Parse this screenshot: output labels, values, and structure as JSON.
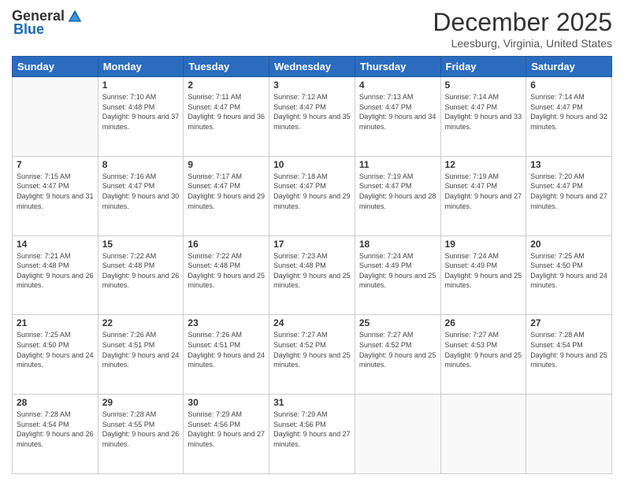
{
  "logo": {
    "general": "General",
    "blue": "Blue"
  },
  "header": {
    "month": "December 2025",
    "location": "Leesburg, Virginia, United States"
  },
  "days_of_week": [
    "Sunday",
    "Monday",
    "Tuesday",
    "Wednesday",
    "Thursday",
    "Friday",
    "Saturday"
  ],
  "weeks": [
    [
      {
        "day": "",
        "sunrise": "",
        "sunset": "",
        "daylight": ""
      },
      {
        "day": "1",
        "sunrise": "Sunrise: 7:10 AM",
        "sunset": "Sunset: 4:48 PM",
        "daylight": "Daylight: 9 hours and 37 minutes."
      },
      {
        "day": "2",
        "sunrise": "Sunrise: 7:11 AM",
        "sunset": "Sunset: 4:47 PM",
        "daylight": "Daylight: 9 hours and 36 minutes."
      },
      {
        "day": "3",
        "sunrise": "Sunrise: 7:12 AM",
        "sunset": "Sunset: 4:47 PM",
        "daylight": "Daylight: 9 hours and 35 minutes."
      },
      {
        "day": "4",
        "sunrise": "Sunrise: 7:13 AM",
        "sunset": "Sunset: 4:47 PM",
        "daylight": "Daylight: 9 hours and 34 minutes."
      },
      {
        "day": "5",
        "sunrise": "Sunrise: 7:14 AM",
        "sunset": "Sunset: 4:47 PM",
        "daylight": "Daylight: 9 hours and 33 minutes."
      },
      {
        "day": "6",
        "sunrise": "Sunrise: 7:14 AM",
        "sunset": "Sunset: 4:47 PM",
        "daylight": "Daylight: 9 hours and 32 minutes."
      }
    ],
    [
      {
        "day": "7",
        "sunrise": "Sunrise: 7:15 AM",
        "sunset": "Sunset: 4:47 PM",
        "daylight": "Daylight: 9 hours and 31 minutes."
      },
      {
        "day": "8",
        "sunrise": "Sunrise: 7:16 AM",
        "sunset": "Sunset: 4:47 PM",
        "daylight": "Daylight: 9 hours and 30 minutes."
      },
      {
        "day": "9",
        "sunrise": "Sunrise: 7:17 AM",
        "sunset": "Sunset: 4:47 PM",
        "daylight": "Daylight: 9 hours and 29 minutes."
      },
      {
        "day": "10",
        "sunrise": "Sunrise: 7:18 AM",
        "sunset": "Sunset: 4:47 PM",
        "daylight": "Daylight: 9 hours and 29 minutes."
      },
      {
        "day": "11",
        "sunrise": "Sunrise: 7:19 AM",
        "sunset": "Sunset: 4:47 PM",
        "daylight": "Daylight: 9 hours and 28 minutes."
      },
      {
        "day": "12",
        "sunrise": "Sunrise: 7:19 AM",
        "sunset": "Sunset: 4:47 PM",
        "daylight": "Daylight: 9 hours and 27 minutes."
      },
      {
        "day": "13",
        "sunrise": "Sunrise: 7:20 AM",
        "sunset": "Sunset: 4:47 PM",
        "daylight": "Daylight: 9 hours and 27 minutes."
      }
    ],
    [
      {
        "day": "14",
        "sunrise": "Sunrise: 7:21 AM",
        "sunset": "Sunset: 4:48 PM",
        "daylight": "Daylight: 9 hours and 26 minutes."
      },
      {
        "day": "15",
        "sunrise": "Sunrise: 7:22 AM",
        "sunset": "Sunset: 4:48 PM",
        "daylight": "Daylight: 9 hours and 26 minutes."
      },
      {
        "day": "16",
        "sunrise": "Sunrise: 7:22 AM",
        "sunset": "Sunset: 4:48 PM",
        "daylight": "Daylight: 9 hours and 25 minutes."
      },
      {
        "day": "17",
        "sunrise": "Sunrise: 7:23 AM",
        "sunset": "Sunset: 4:48 PM",
        "daylight": "Daylight: 9 hours and 25 minutes."
      },
      {
        "day": "18",
        "sunrise": "Sunrise: 7:24 AM",
        "sunset": "Sunset: 4:49 PM",
        "daylight": "Daylight: 9 hours and 25 minutes."
      },
      {
        "day": "19",
        "sunrise": "Sunrise: 7:24 AM",
        "sunset": "Sunset: 4:49 PM",
        "daylight": "Daylight: 9 hours and 25 minutes."
      },
      {
        "day": "20",
        "sunrise": "Sunrise: 7:25 AM",
        "sunset": "Sunset: 4:50 PM",
        "daylight": "Daylight: 9 hours and 24 minutes."
      }
    ],
    [
      {
        "day": "21",
        "sunrise": "Sunrise: 7:25 AM",
        "sunset": "Sunset: 4:50 PM",
        "daylight": "Daylight: 9 hours and 24 minutes."
      },
      {
        "day": "22",
        "sunrise": "Sunrise: 7:26 AM",
        "sunset": "Sunset: 4:51 PM",
        "daylight": "Daylight: 9 hours and 24 minutes."
      },
      {
        "day": "23",
        "sunrise": "Sunrise: 7:26 AM",
        "sunset": "Sunset: 4:51 PM",
        "daylight": "Daylight: 9 hours and 24 minutes."
      },
      {
        "day": "24",
        "sunrise": "Sunrise: 7:27 AM",
        "sunset": "Sunset: 4:52 PM",
        "daylight": "Daylight: 9 hours and 25 minutes."
      },
      {
        "day": "25",
        "sunrise": "Sunrise: 7:27 AM",
        "sunset": "Sunset: 4:52 PM",
        "daylight": "Daylight: 9 hours and 25 minutes."
      },
      {
        "day": "26",
        "sunrise": "Sunrise: 7:27 AM",
        "sunset": "Sunset: 4:53 PM",
        "daylight": "Daylight: 9 hours and 25 minutes."
      },
      {
        "day": "27",
        "sunrise": "Sunrise: 7:28 AM",
        "sunset": "Sunset: 4:54 PM",
        "daylight": "Daylight: 9 hours and 25 minutes."
      }
    ],
    [
      {
        "day": "28",
        "sunrise": "Sunrise: 7:28 AM",
        "sunset": "Sunset: 4:54 PM",
        "daylight": "Daylight: 9 hours and 26 minutes."
      },
      {
        "day": "29",
        "sunrise": "Sunrise: 7:28 AM",
        "sunset": "Sunset: 4:55 PM",
        "daylight": "Daylight: 9 hours and 26 minutes."
      },
      {
        "day": "30",
        "sunrise": "Sunrise: 7:29 AM",
        "sunset": "Sunset: 4:56 PM",
        "daylight": "Daylight: 9 hours and 27 minutes."
      },
      {
        "day": "31",
        "sunrise": "Sunrise: 7:29 AM",
        "sunset": "Sunset: 4:56 PM",
        "daylight": "Daylight: 9 hours and 27 minutes."
      },
      {
        "day": "",
        "sunrise": "",
        "sunset": "",
        "daylight": ""
      },
      {
        "day": "",
        "sunrise": "",
        "sunset": "",
        "daylight": ""
      },
      {
        "day": "",
        "sunrise": "",
        "sunset": "",
        "daylight": ""
      }
    ]
  ]
}
